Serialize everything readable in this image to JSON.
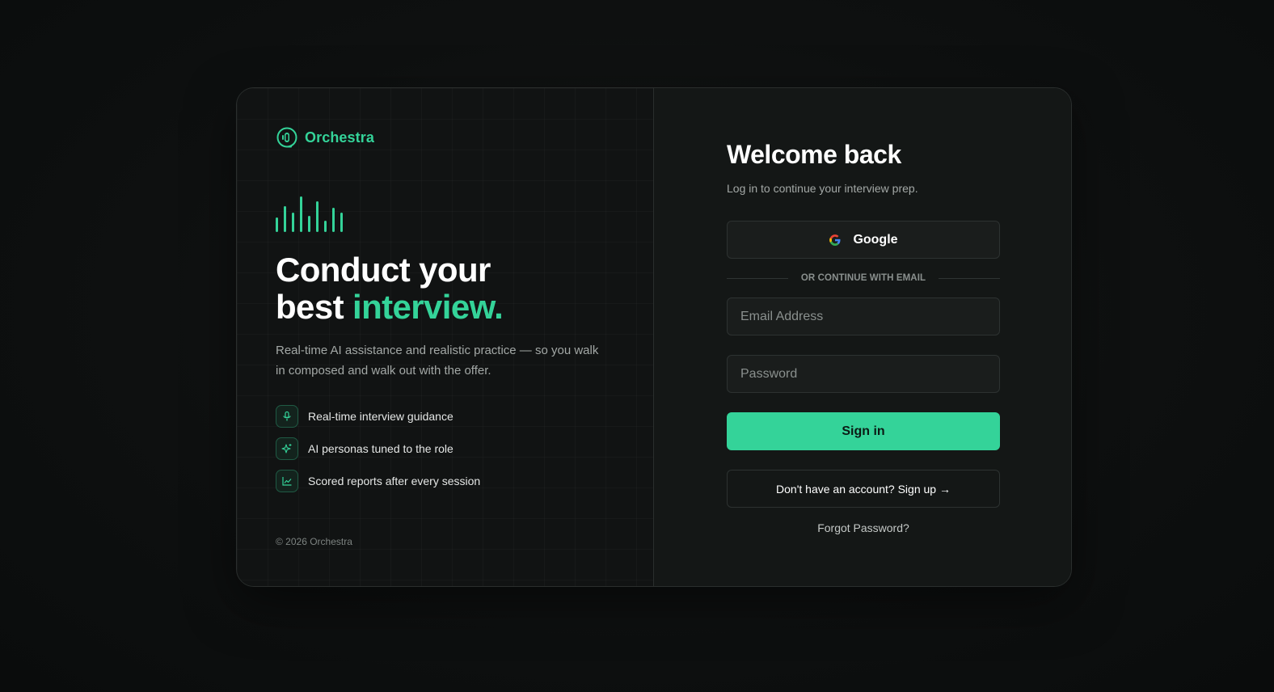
{
  "brand": {
    "name": "Orchestra",
    "icon": "headset-logo-icon",
    "accent_color": "#34d399"
  },
  "hero": {
    "headline_line1": "Conduct your",
    "headline_line2_plain": "best ",
    "headline_line2_accent": "interview.",
    "subtext": "Real-time AI assistance and realistic practice — so you walk in composed and walk out with the offer."
  },
  "features": [
    {
      "icon": "microphone-icon",
      "label": "Real-time interview guidance"
    },
    {
      "icon": "sparkle-icon",
      "label": "AI personas tuned to the role"
    },
    {
      "icon": "chart-icon",
      "label": "Scored reports after every session"
    }
  ],
  "footer": {
    "copyright": "© 2026 Orchestra"
  },
  "login": {
    "title": "Welcome back",
    "subtitle": "Log in to continue your interview prep.",
    "google_label": "Google",
    "divider_text": "OR CONTINUE WITH EMAIL",
    "email_placeholder": "Email Address",
    "password_placeholder": "Password",
    "signin_label": "Sign in",
    "signup_label": "Don't have an account? Sign up →",
    "forgot_label": "Forgot Password?"
  },
  "colors": {
    "background": "#0d0f0f",
    "card": "#141716",
    "accent": "#34d399"
  }
}
